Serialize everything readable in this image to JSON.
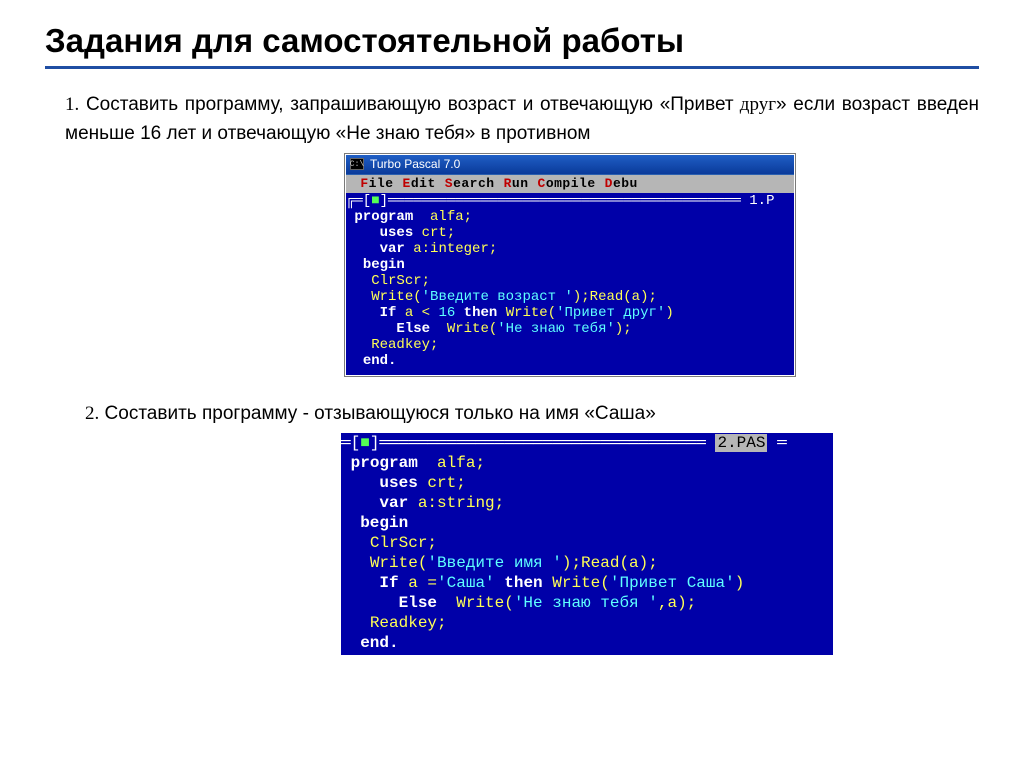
{
  "title": "Задания для самостоятельной работы",
  "task1": {
    "num": "1.",
    "text_a": "Составить   программу,   запрашивающую   возраст   и   отвечающую «Привет",
    "text_friend": " друг",
    "text_b": "»  если  возраст  введен  меньше  16  лет  и  отвечающую  «Не знаю  тебя»  в  противном"
  },
  "tp1": {
    "title": "Turbo Pascal 7.0",
    "menu": [
      {
        "hot": "F",
        "rest": "ile"
      },
      {
        "hot": "E",
        "rest": "dit"
      },
      {
        "hot": "S",
        "rest": "earch"
      },
      {
        "hot": "R",
        "rest": "un"
      },
      {
        "hot": "C",
        "rest": "ompile"
      },
      {
        "hot": "D",
        "rest": "ebu"
      }
    ],
    "frame_tag": "1.P",
    "code_lines_html": [
      "<span class='kw'>program</span>  <span class='id'>alfa;</span>",
      "   <span class='kw'>uses</span> <span class='id'>crt;</span>",
      "   <span class='kw'>var</span> <span class='id'>a:integer;</span>",
      " <span class='kw'>begin</span>",
      "  <span class='id'>ClrScr;</span>",
      "  <span class='id'>Write(</span><span class='str'>'Введите возраст '</span><span class='id'>);Read(a);</span>",
      "   <span class='kw'>If</span> <span class='id'>a <</span> <span class='sy'>16</span> <span class='kw'>then</span> <span class='id'>Write(</span><span class='str'>'Привет друг'</span><span class='id'>)</span>",
      "     <span class='kw'>Else</span>  <span class='id'>Write(</span><span class='str'>'Не знаю тебя'</span><span class='id'>);</span>",
      "  <span class='id'>Readkey;</span>",
      " <span class='kw'>end.</span>"
    ]
  },
  "task2": {
    "num": "2.",
    "text": "Составить  программу  -  отзывающуюся  только  на  имя «Саша»"
  },
  "tp2": {
    "frame_tag": "2.PAS",
    "code_lines_html": [
      "<span class='kw2'>program</span>  <span class='id2'>alfa;</span>",
      "   <span class='kw2'>uses</span> <span class='id2'>crt;</span>",
      "   <span class='kw2'>var</span> <span class='id2'>a:string;</span>",
      " <span class='kw2'>begin</span>",
      "  <span class='id2'>ClrScr;</span>",
      "  <span class='id2'>Write(</span><span class='str2'>'Введите имя '</span><span class='id2'>);Read(a);</span>",
      "   <span class='kw2'>If</span> <span class='id2'>a =</span><span class='str2'>'Саша'</span> <span class='kw2'>then</span> <span class='id2'>Write(</span><span class='str2'>'Привет Саша'</span><span class='id2'>)</span>",
      "     <span class='kw2'>Else</span>  <span class='id2'>Write(</span><span class='str2'>'Не знаю тебя '</span><span class='id2'>,a);</span>",
      "  <span class='id2'>Readkey;</span>",
      " <span class='kw2'>end.</span>"
    ]
  }
}
